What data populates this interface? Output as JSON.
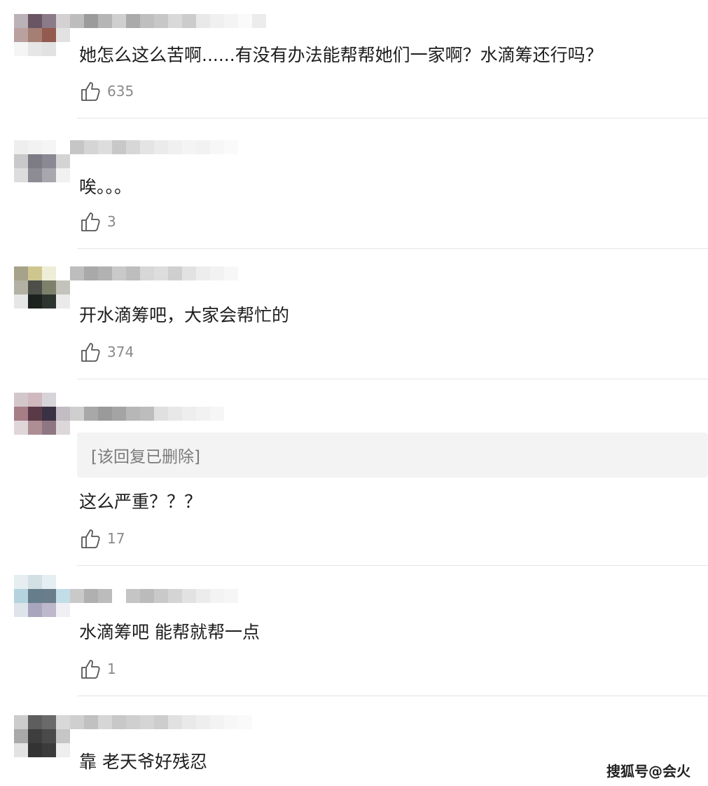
{
  "comments": [
    {
      "text": "她怎么这么苦啊......有没有办法能帮帮她们一家啊？水滴筹还行吗？",
      "likes": "635",
      "avatar_colors": [
        "#bbb2b8",
        "#6a5563",
        "#8b7b88",
        "#d5d0d3",
        "#b9a1a0",
        "#a57e74",
        "#935a4f",
        "#e3e2e2",
        "#f5f5f5",
        "#e6e6e6",
        "#e2e2e2",
        "#ffffff"
      ],
      "username_colors": [
        "#bdbdbd",
        "#9b9b9b",
        "#b5b5b5",
        "#cfcfcf",
        "#aaaaaa",
        "#bfbfbf",
        "#c7c7c7",
        "#d9d9d9",
        "#cccccc",
        "#e9e9e9",
        "#f0f0f0",
        "#f4f4f4",
        "#fafafa",
        "#ececec"
      ]
    },
    {
      "text": "唉。。。",
      "likes": "3",
      "avatar_colors": [
        "#eeeeee",
        "#f2f2f2",
        "#f5f5f5",
        "#ffffff",
        "#c9c9cb",
        "#7d7b83",
        "#8a8892",
        "#d4d4d4",
        "#dddddd",
        "#8d8c95",
        "#a7a7ad",
        "#f1f1f1"
      ],
      "username_colors": [
        "#c6c6c6",
        "#d5d5d5",
        "#dddddd",
        "#c8c8c8",
        "#d7d7d7",
        "#e4e4e4",
        "#ebebeb",
        "#f0f0f0",
        "#f4f4f4",
        "#f2f2f2",
        "#f7f7f7",
        "#fafafa"
      ]
    },
    {
      "text": "开水滴筹吧，大家会帮忙的",
      "likes": "374",
      "avatar_colors": [
        "#a6a38a",
        "#cfc68f",
        "#eeeed8",
        "#ffffff",
        "#b2b1a4",
        "#4c5049",
        "#7d816c",
        "#c3c3bb",
        "#e6e6e6",
        "#1d221f",
        "#2e3530",
        "#eaeaea"
      ],
      "username_colors": [
        "#bdbdbd",
        "#a9a9a9",
        "#b2b2b2",
        "#c9c9c9",
        "#bdbdbd",
        "#d7d7d7",
        "#dddddd",
        "#cfcfcf",
        "#e2e2e2",
        "#ededed",
        "#f2f2f2",
        "#f7f7f7"
      ]
    },
    {
      "text": "这么严重？？？",
      "likes": "17",
      "deleted_reply": "[该回复已删除]",
      "avatar_colors": [
        "#d3c7cb",
        "#cfb9bf",
        "#d7d4d9",
        "#ffffff",
        "#a77d86",
        "#5b3a47",
        "#3a3244",
        "#c3bdc3",
        "#dfd6d9",
        "#ae8d95",
        "#8f7683",
        "#ded7d9"
      ],
      "username_colors": [
        "#cfcfcf",
        "#a8a8a8",
        "#9a9a9a",
        "#a4a4a4",
        "#b7b7b7",
        "#bdbdbd",
        "#e0e0e0",
        "#e8e8e8",
        "#eeeeee",
        "#f2f2f2",
        "#f6f6f6"
      ]
    },
    {
      "text": "水滴筹吧 能帮就帮一点",
      "likes": "1",
      "avatar_colors": [
        "#e6eef1",
        "#d2dfe4",
        "#e5eef2",
        "#ffffff",
        "#b5d3de",
        "#667e8c",
        "#6b7d8b",
        "#c2dde7",
        "#dde4ea",
        "#a9a5bd",
        "#bdb8cc",
        "#f0f0f4"
      ],
      "username_colors": [
        "#c9c9c9",
        "#b0b0b0",
        "#bcbcbc",
        "#ffffff",
        "#c5c5c5",
        "#bbbbbb",
        "#c9c9c9",
        "#d4d4d4",
        "#e2e2e2",
        "#ececec",
        "#f3f3f3",
        "#f6f6f6"
      ]
    },
    {
      "text": "靠 老天爷好残忍",
      "likes": "",
      "avatar_colors": [
        "#cccccc",
        "#5e5e5e",
        "#6a6a6a",
        "#d8d8d8",
        "#a9a9a9",
        "#3e3e3e",
        "#4a4a4a",
        "#c6c6c6",
        "#e3e3e3",
        "#333333",
        "#3b3b3b",
        "#eeeeee"
      ],
      "username_colors": [
        "#cfcfcf",
        "#c1c1c1",
        "#d6d6d6",
        "#c8c8c8",
        "#cfcfcf",
        "#d5d5d5",
        "#cdcdcd",
        "#e1e1e1",
        "#e9e9e9",
        "#eeeeee",
        "#f3f3f3",
        "#f7f7f7",
        "#fafafa"
      ]
    }
  ],
  "watermark": "搜狐号@会火",
  "icons": {
    "like": "thumbs-up-icon"
  },
  "colors": {
    "text": "#1d1d1d",
    "like_count": "#8a8a8a",
    "divider": "#e5e5e5",
    "deleted_bg": "#f3f3f3"
  }
}
